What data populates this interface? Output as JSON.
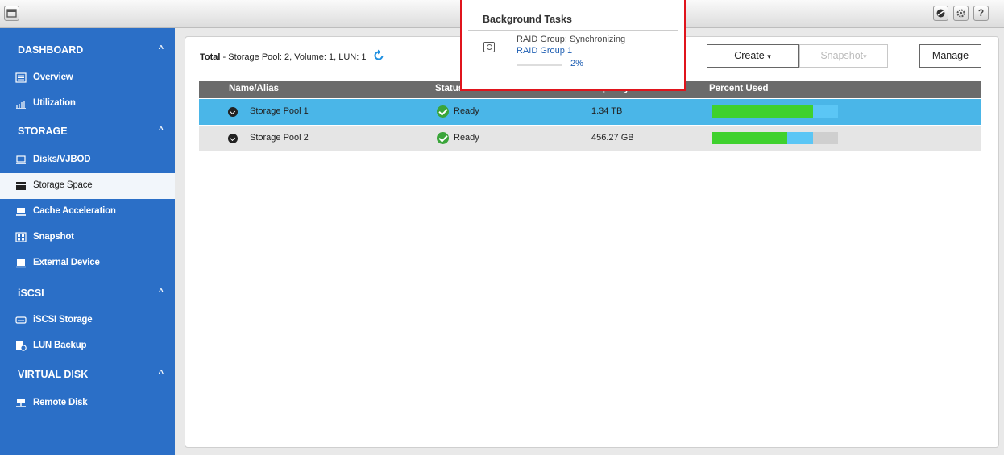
{
  "topbar": {
    "menu_icon": "window-icon",
    "right_icons": [
      "qsync-icon",
      "gear-icon"
    ],
    "help_label": "?"
  },
  "sidebar": {
    "sections": [
      {
        "label": "DASHBOARD",
        "chevron": "^"
      },
      {
        "label": "STORAGE",
        "chevron": "^"
      },
      {
        "label": "iSCSI",
        "chevron": "^"
      },
      {
        "label": "VIRTUAL DISK",
        "chevron": "^"
      }
    ],
    "items": [
      {
        "label": "Overview",
        "icon": "overview-icon"
      },
      {
        "label": "Utilization",
        "icon": "chart-icon"
      },
      {
        "label": "Disks/VJBOD",
        "icon": "disk-icon"
      },
      {
        "label": "Storage Space",
        "icon": "storage-icon",
        "active": true
      },
      {
        "label": "Cache Acceleration",
        "icon": "cache-icon"
      },
      {
        "label": "Snapshot",
        "icon": "snapshot-icon"
      },
      {
        "label": "External Device",
        "icon": "external-device-icon"
      },
      {
        "label": "iSCSI Storage",
        "icon": "iscsi-icon"
      },
      {
        "label": "LUN Backup",
        "icon": "lun-backup-icon"
      },
      {
        "label": "Remote Disk",
        "icon": "remote-disk-icon"
      }
    ]
  },
  "summary": {
    "prefix": "Total",
    "text": " - Storage Pool: 2, Volume: 1, LUN: 1"
  },
  "buttons": {
    "create": "Create",
    "snapshot": "Snapshot",
    "manage": "Manage",
    "dropdown_glyph": "▾"
  },
  "table": {
    "headers": [
      "Name/Alias",
      "Status",
      "Capacity",
      "Percent Used"
    ],
    "rows": [
      {
        "name": "Storage Pool 1",
        "status": "Ready",
        "capacity": "1.34 TB",
        "used_fraction": 0.8,
        "snapshot_fraction": 0.2
      },
      {
        "name": "Storage Pool 2",
        "status": "Ready",
        "capacity": "456.27 GB",
        "used_fraction": 0.6,
        "snapshot_fraction": 0.2
      }
    ]
  },
  "background_tasks": {
    "title": "Background Tasks",
    "task_line1": "RAID Group: Synchronizing",
    "task_line2": "RAID Group 1",
    "progress_text": "2%",
    "progress_fraction": 0.02
  },
  "colors": {
    "sidebar": "#2b6fc7",
    "selected_row": "#4ab6e8",
    "used": "#3fd12e",
    "snapshot": "#5bc6f5",
    "popup_border": "#e0141c"
  }
}
